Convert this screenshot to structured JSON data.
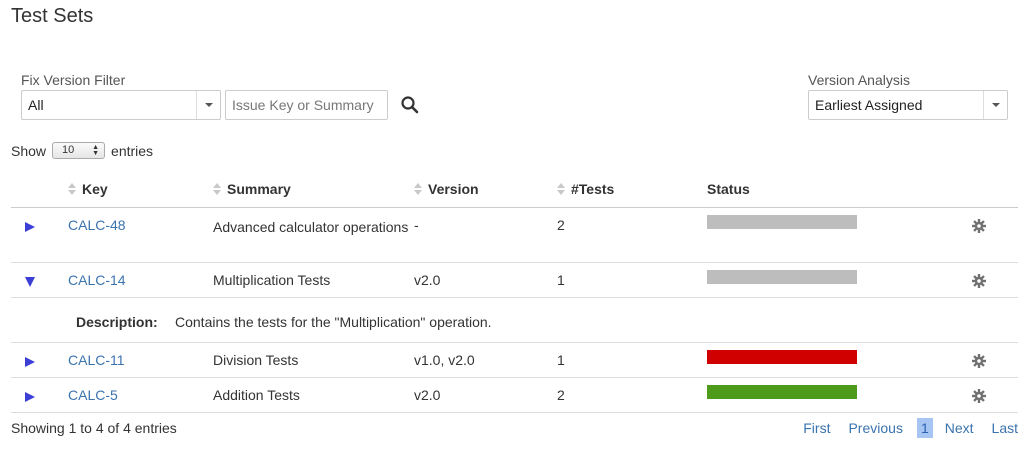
{
  "page": {
    "title": "Test Sets"
  },
  "filters": {
    "fix_version_label": "Fix Version Filter",
    "fix_version_value": "All",
    "search_placeholder": "Issue Key or Summary",
    "analysis_label": "Version Analysis",
    "analysis_value": "Earliest Assigned"
  },
  "length": {
    "show_label": "Show",
    "value": "10",
    "entries_label": "entries"
  },
  "table": {
    "headers": [
      "Key",
      "Summary",
      "Version",
      "#Tests",
      "Status"
    ],
    "rows": [
      {
        "key": "CALC-48",
        "summary": "Advanced calculator operations",
        "version": "-",
        "tests": "2",
        "status_color": "#bdbdbd",
        "expanded": false
      },
      {
        "key": "CALC-14",
        "summary": "Multiplication Tests",
        "version": "v2.0",
        "tests": "1",
        "status_color": "#bdbdbd",
        "expanded": true
      },
      {
        "key": "CALC-11",
        "summary": "Division Tests",
        "version": "v1.0, v2.0",
        "tests": "1",
        "status_color": "#d00000",
        "expanded": false
      },
      {
        "key": "CALC-5",
        "summary": "Addition Tests",
        "version": "v2.0",
        "tests": "2",
        "status_color": "#4e9a1a",
        "expanded": false
      }
    ],
    "detail": {
      "label": "Description:",
      "text": "Contains the tests for the \"Multiplication\" operation."
    }
  },
  "footer": {
    "info": "Showing 1 to 4 of 4 entries",
    "first": "First",
    "previous": "Previous",
    "current_page": "1",
    "next": "Next",
    "last": "Last"
  },
  "colors": {
    "link": "#3b73af",
    "expand_arrow": "#3b3fd6",
    "current_page_bg": "#a7c5f2"
  }
}
